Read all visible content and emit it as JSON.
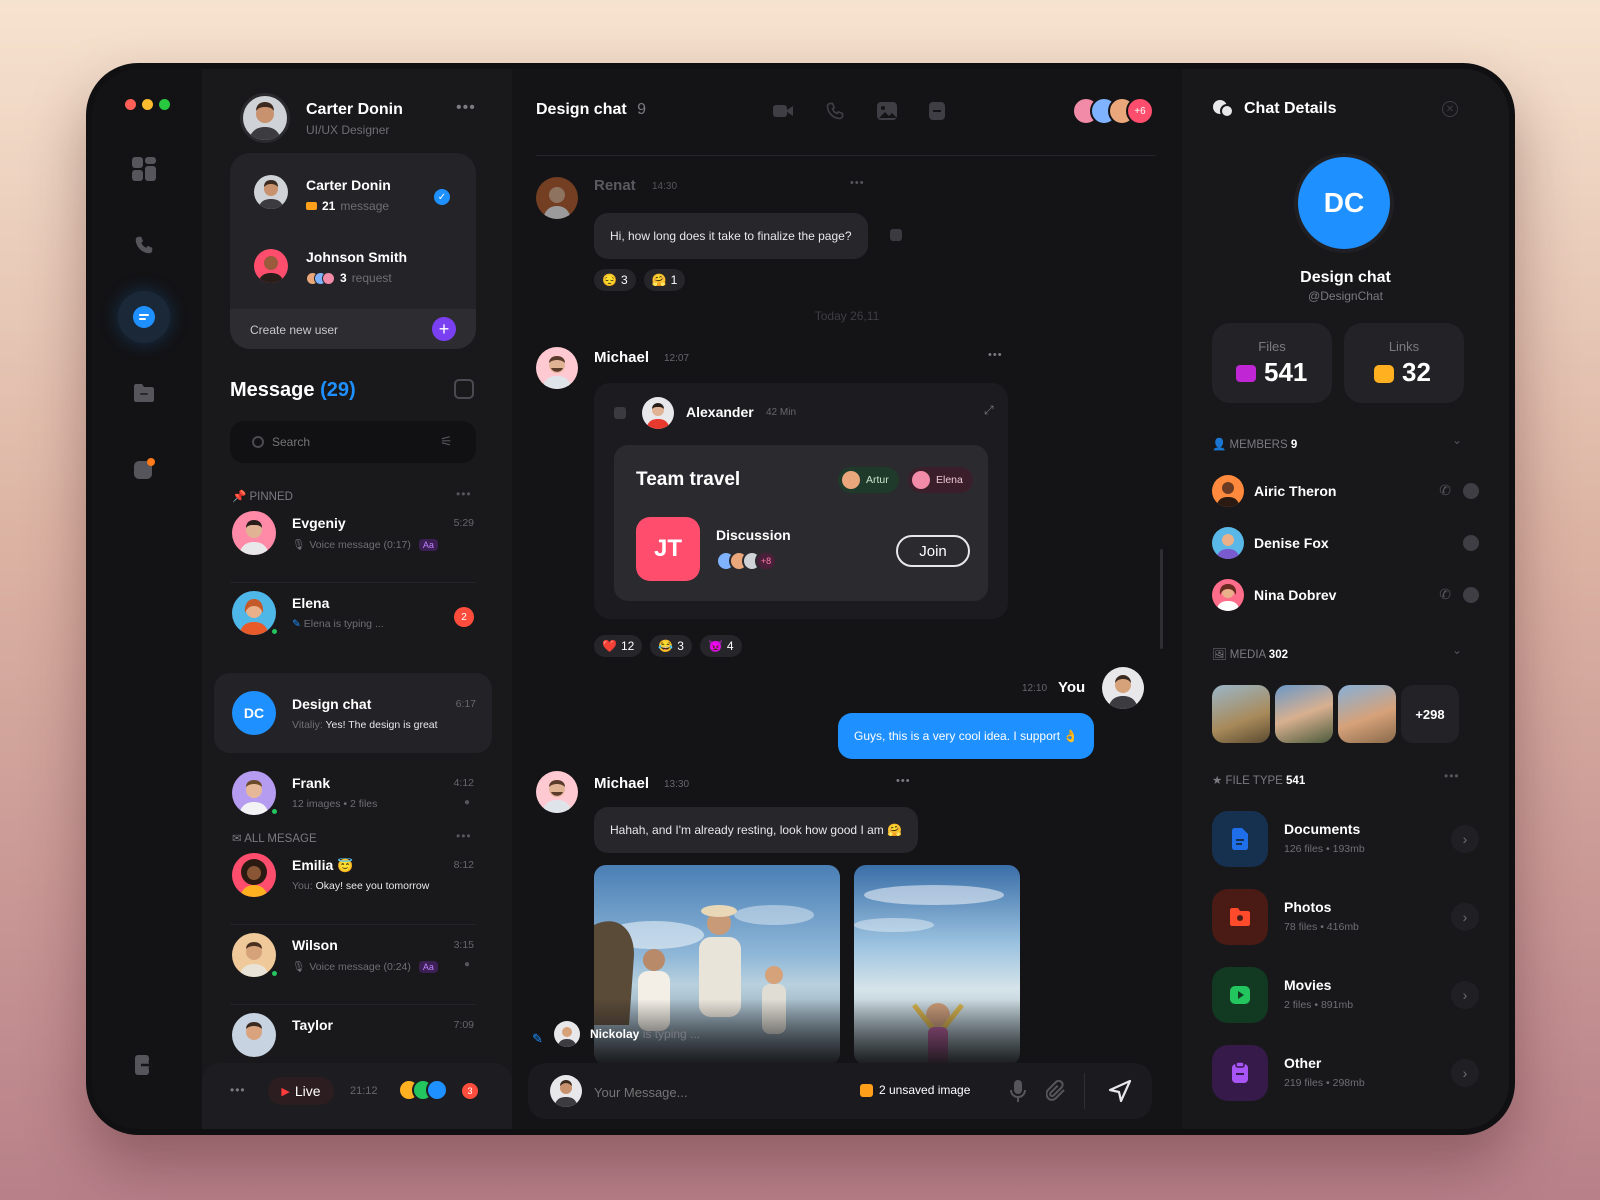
{
  "window_dots": [
    "#ff5f57",
    "#febc2e",
    "#28c840"
  ],
  "account": {
    "name": "Carter Donin",
    "role": "UI/UX Designer"
  },
  "switcher": {
    "users": [
      {
        "name": "Carter Donin",
        "count": "21",
        "count_label": "message"
      },
      {
        "name": "Johnson Smith",
        "count": "3",
        "count_label": "request"
      }
    ],
    "create_label": "Create new user"
  },
  "messages": {
    "title": "Message",
    "count": "(29)",
    "search_placeholder": "Search",
    "pinned_label": "PINNED",
    "all_label": "ALL MESAGE"
  },
  "conversations": {
    "evgeniy": {
      "name": "Evgeniy",
      "preview": "Voice message (0:17)",
      "tag": "Aa",
      "time": "5:29"
    },
    "elena": {
      "name": "Elena",
      "preview": "Elena is typing ...",
      "badge": "2"
    },
    "design": {
      "initials": "DC",
      "name": "Design chat",
      "sender": "Vitaliy:",
      "preview": "Yes! The design is great",
      "time": "6:17"
    },
    "frank": {
      "name": "Frank",
      "images": "12 images",
      "files": "2 files",
      "time": "4:12"
    },
    "emilia": {
      "name": "Emilia",
      "sender": "You:",
      "preview": "Okay! see you tomorrow",
      "time": "8:12"
    },
    "wilson": {
      "name": "Wilson",
      "preview": "Voice message (0:24)",
      "tag": "Aa",
      "time": "3:15"
    },
    "taylor": {
      "name": "Taylor",
      "time": "7:09"
    }
  },
  "live_bar": {
    "label": "Live",
    "time": "21:12",
    "badge": "3"
  },
  "chat": {
    "title": "Design chat",
    "count": "9",
    "extra_members": "+6",
    "renat": {
      "name": "Renat",
      "time": "14:30",
      "text": "Hi, how long does it take to finalize the page?",
      "reactions": [
        {
          "e": "😔",
          "n": "3"
        },
        {
          "e": "🤗",
          "n": "1"
        }
      ]
    },
    "divider": "Today 26,11",
    "michael1": {
      "name": "Michael",
      "time": "12:07"
    },
    "card": {
      "author": "Alexander",
      "time": "42 Min",
      "title": "Team travel",
      "tags": [
        "Artur",
        "Elena"
      ],
      "initials": "JT",
      "subtitle": "Discussion",
      "extra": "+8",
      "join": "Join"
    },
    "reactions2": [
      {
        "e": "❤️",
        "n": "12"
      },
      {
        "e": "😂",
        "n": "3"
      },
      {
        "e": "👿",
        "n": "4"
      }
    ],
    "you": {
      "name": "You",
      "time": "12:10",
      "text": "Guys, this is a very cool idea. I support 👌"
    },
    "michael2": {
      "name": "Michael",
      "time": "13:30",
      "text": "Hahah, and I'm already resting, look how good I am 🤗"
    },
    "typing": {
      "name": "Nickolay",
      "text": "is typing ..."
    },
    "composer": {
      "placeholder": "Your Message...",
      "unsaved": "2 unsaved image"
    }
  },
  "details": {
    "title": "Chat Details",
    "initials": "DC",
    "name": "Design chat",
    "handle": "@DesignChat",
    "files": {
      "label": "Files",
      "value": "541"
    },
    "links": {
      "label": "Links",
      "value": "32"
    },
    "members_label": "MEMBERS",
    "members_count": "9",
    "members": [
      "Airic Theron",
      "Denise Fox",
      "Nina Dobrev"
    ],
    "media_label": "MEDIA",
    "media_count": "302",
    "media_more": "+298",
    "filetype_label": "FILE TYPE",
    "filetype_count": "541",
    "types": [
      {
        "name": "Documents",
        "files": "126 files",
        "size": "193mb",
        "color": "#1f6feb"
      },
      {
        "name": "Photos",
        "files": "78 files",
        "size": "416mb",
        "color": "#ff4b2b"
      },
      {
        "name": "Movies",
        "files": "2 files",
        "size": "891mb",
        "color": "#22c55e"
      },
      {
        "name": "Other",
        "files": "219 files",
        "size": "298mb",
        "color": "#a855f7"
      }
    ]
  },
  "colors": {
    "accent": "#1e90ff",
    "purple": "#7b3ff2",
    "danger": "#ff4d3d",
    "pink": "#ff4d6d"
  }
}
